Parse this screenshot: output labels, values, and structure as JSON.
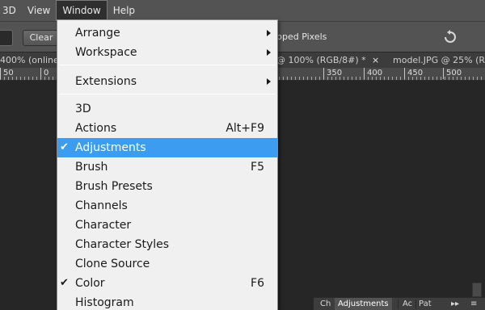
{
  "menubar": {
    "items": [
      "3D",
      "View",
      "Window",
      "Help"
    ],
    "active": "Window"
  },
  "options": {
    "clear_label": "Clear",
    "cropped_text": "pped Pixels"
  },
  "tabs": {
    "tab1": "400% (online",
    "tab2": "@ 100% (RGB/8#) *",
    "tab2_close": "×",
    "tab3": "model.JPG @ 25% (R"
  },
  "ruler": {
    "labels": [
      "50",
      "0",
      "350",
      "400",
      "450",
      "500"
    ]
  },
  "window_menu": {
    "group1": [
      {
        "label": "Arrange",
        "submenu": true
      },
      {
        "label": "Workspace",
        "submenu": true
      }
    ],
    "group2": [
      {
        "label": "Extensions",
        "submenu": true
      }
    ],
    "group3": [
      {
        "label": "3D",
        "shortcut": "",
        "checked": false
      },
      {
        "label": "Actions",
        "shortcut": "Alt+F9",
        "checked": false
      },
      {
        "label": "Adjustments",
        "shortcut": "",
        "checked": true,
        "highlighted": true
      },
      {
        "label": "Brush",
        "shortcut": "F5",
        "checked": false
      },
      {
        "label": "Brush Presets",
        "shortcut": "",
        "checked": false
      },
      {
        "label": "Channels",
        "shortcut": "",
        "checked": false
      },
      {
        "label": "Character",
        "shortcut": "",
        "checked": false
      },
      {
        "label": "Character Styles",
        "shortcut": "",
        "checked": false
      },
      {
        "label": "Clone Source",
        "shortcut": "",
        "checked": false
      },
      {
        "label": "Color",
        "shortcut": "F6",
        "checked": true
      },
      {
        "label": "Histogram",
        "shortcut": "",
        "checked": false
      }
    ],
    "check_glyph": "✔"
  },
  "panel": {
    "tabs": [
      "Ch",
      "Adjustments",
      "Ac",
      "Pat"
    ],
    "active": "Adjustments",
    "collapse_glyph": "▸▸",
    "menu_glyph": "≡"
  },
  "colors": {
    "highlight": "#3c9df0",
    "menubar": "#535353",
    "canvas": "#262626"
  }
}
